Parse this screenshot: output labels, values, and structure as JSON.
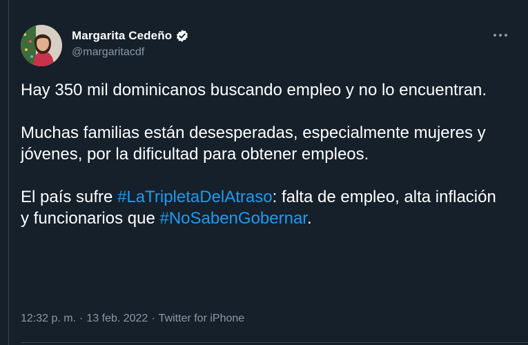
{
  "author": {
    "display_name": "Margarita Cedeño",
    "handle": "@margaritacdf",
    "verified": true,
    "avatar_icon": "profile-photo"
  },
  "tweet": {
    "paragraph1": "Hay 350 mil dominicanos buscando empleo y no lo encuentran.",
    "paragraph2": "Muchas familias están desesperadas, especialmente mujeres y jóvenes, por la dificultad para obtener empleos.",
    "paragraph3_part1": "El país sufre ",
    "hashtag1": "#LaTripletaDelAtraso",
    "paragraph3_part2": ": falta de empleo, alta inflación y funcionarios que ",
    "hashtag2": "#NoSabenGobernar",
    "paragraph3_part3": "."
  },
  "meta": {
    "time": "12:32 p. m.",
    "separator1": "·",
    "date": "13 feb. 2022",
    "separator2": "·",
    "source": "Twitter for iPhone"
  },
  "icons": {
    "verified": "verified-badge-icon",
    "more": "more-options-icon"
  },
  "colors": {
    "background": "#15202b",
    "text": "#ffffff",
    "secondary": "#8b98a5",
    "link": "#1d9bf0",
    "border": "#38444d"
  }
}
